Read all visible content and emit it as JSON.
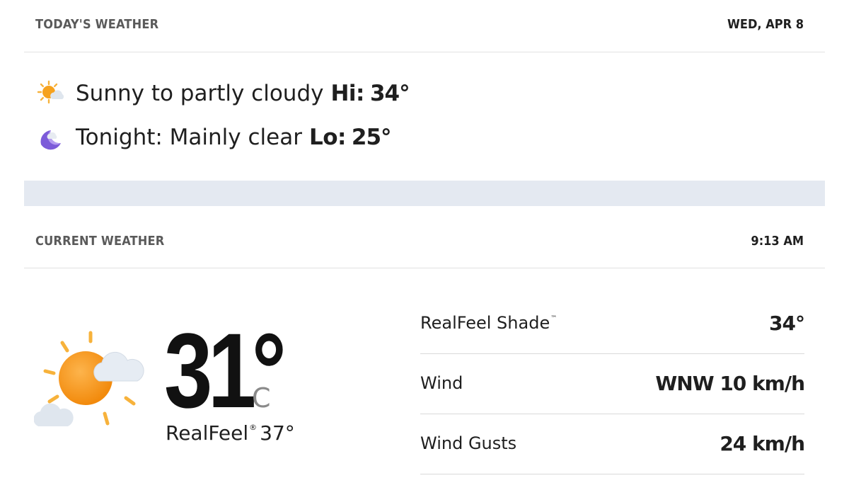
{
  "today": {
    "title": "TODAY'S WEATHER",
    "date": "WED, APR 8",
    "day": {
      "icon": "sun-cloud-icon",
      "condition": "Sunny to partly cloudy",
      "temp_label": "Hi:",
      "temp_value": "34°"
    },
    "night": {
      "icon": "moon-icon",
      "condition": "Tonight: Mainly clear",
      "temp_label": "Lo:",
      "temp_value": "25°"
    }
  },
  "current": {
    "title": "CURRENT WEATHER",
    "time": "9:13 AM",
    "icon": "sun-clouds-icon",
    "temperature": "31°",
    "unit": "C",
    "realfeel_label": "RealFeel",
    "realfeel_mark": "®",
    "realfeel_value": "37°",
    "details": [
      {
        "label": "RealFeel Shade",
        "mark": "™",
        "value": "34°"
      },
      {
        "label": "Wind",
        "mark": "",
        "value": "WNW 10 km/h"
      },
      {
        "label": "Wind Gusts",
        "mark": "",
        "value": "24 km/h"
      }
    ]
  },
  "colors": {
    "accent_sun": "#f5a623",
    "band": "#e4e9f1",
    "moon": "#7b5cd6"
  }
}
